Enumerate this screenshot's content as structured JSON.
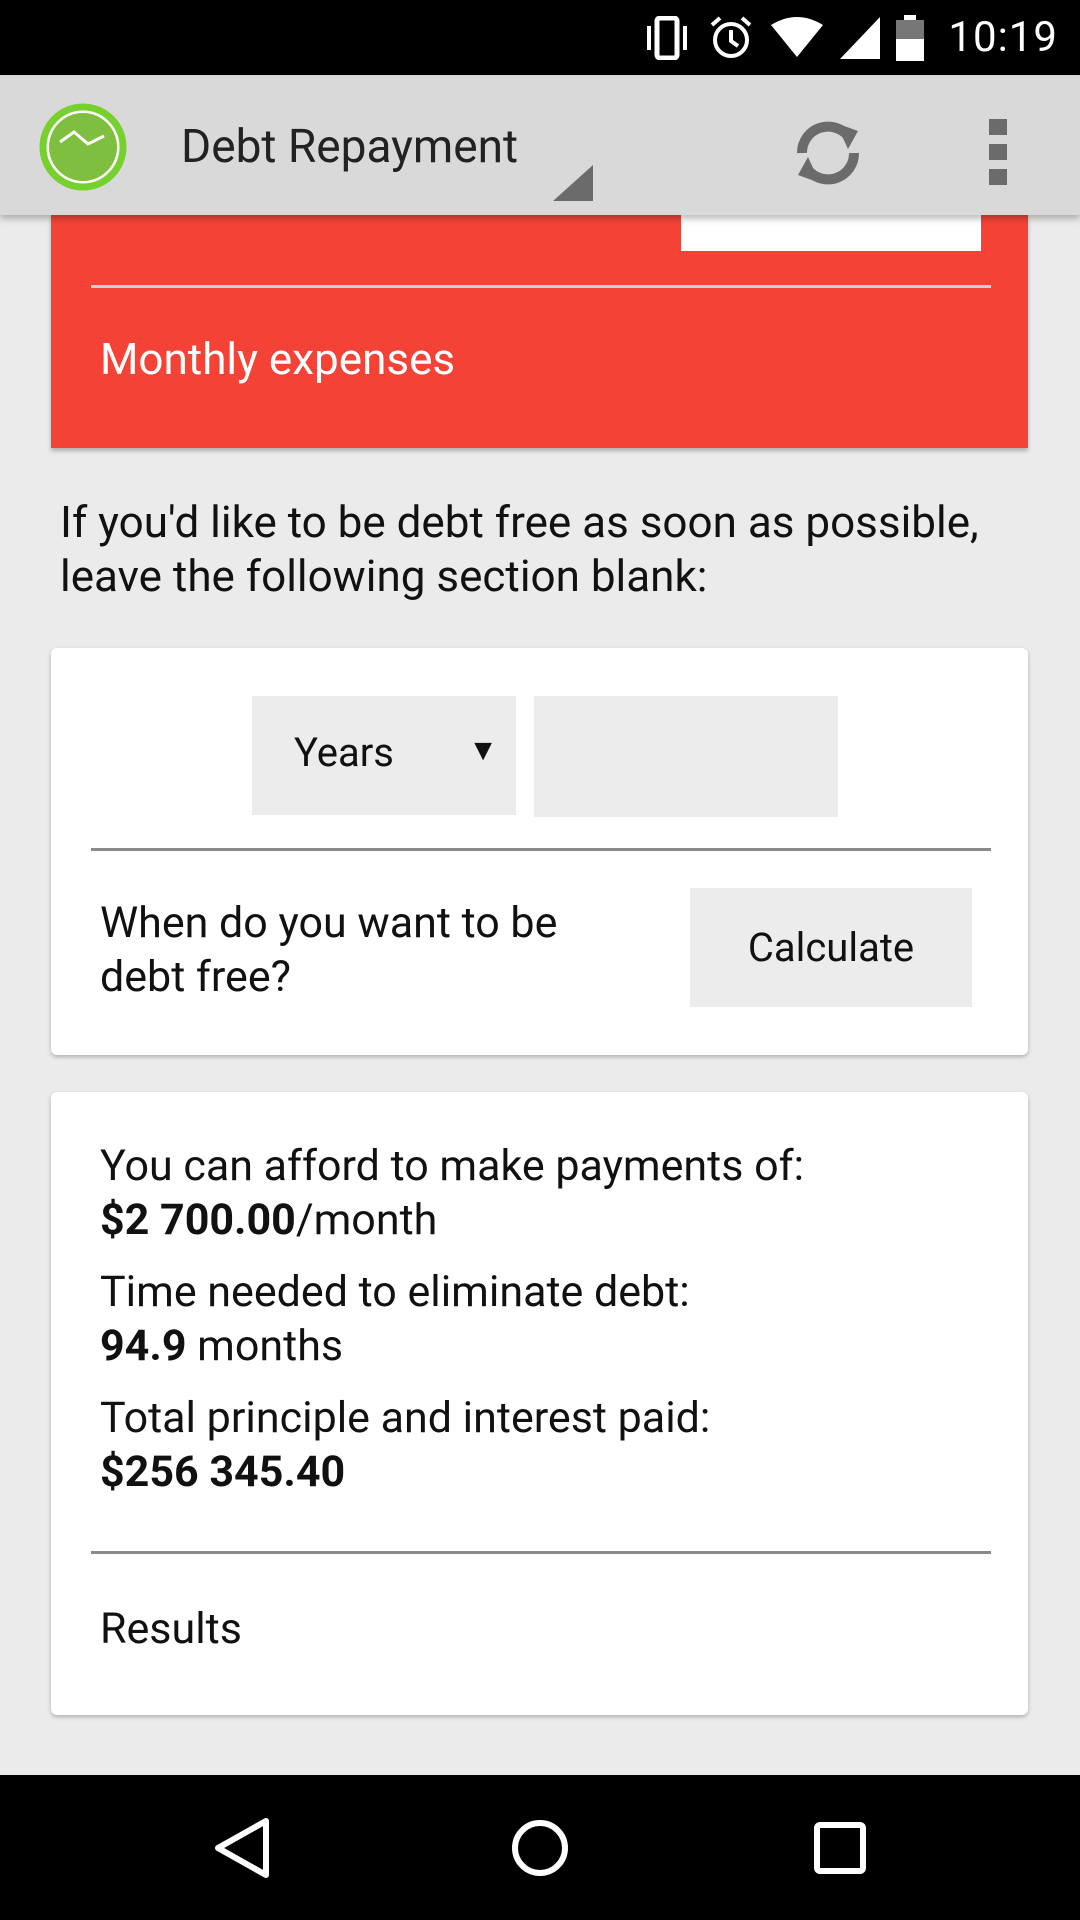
{
  "status_bar": {
    "time": "10:19",
    "icons": [
      "vibrate-icon",
      "alarm-icon",
      "wifi-icon",
      "cell-signal-icon",
      "battery-icon"
    ]
  },
  "action_bar": {
    "title": "Debt Repayment",
    "icons": [
      "app-logo-icon",
      "refresh-icon",
      "overflow-menu-icon"
    ],
    "colors": {
      "bar": "#d9d9d9",
      "logo_ring": "#76d12e"
    }
  },
  "expenses_card": {
    "label": "Monthly expenses",
    "color": "#f44336"
  },
  "instruction": "If you'd like to be debt free as soon as possible, leave the following section blank:",
  "target_form": {
    "unit_select": "Years",
    "number_value": "",
    "question": "When do you want to be debt free?",
    "calculate_label": "Calculate"
  },
  "results": {
    "payment_label": "You can afford to make payments of:",
    "payment_value": "$2 700.00",
    "payment_unit": "/month",
    "time_label": "Time needed to eliminate debt:",
    "time_value": "94.9",
    "time_unit": " months",
    "total_label": "Total principle and interest paid:",
    "total_value": "$256 345.40",
    "section_label": "Results"
  },
  "nav_bar": {
    "icons": [
      "back-icon",
      "home-icon",
      "recents-icon"
    ]
  }
}
